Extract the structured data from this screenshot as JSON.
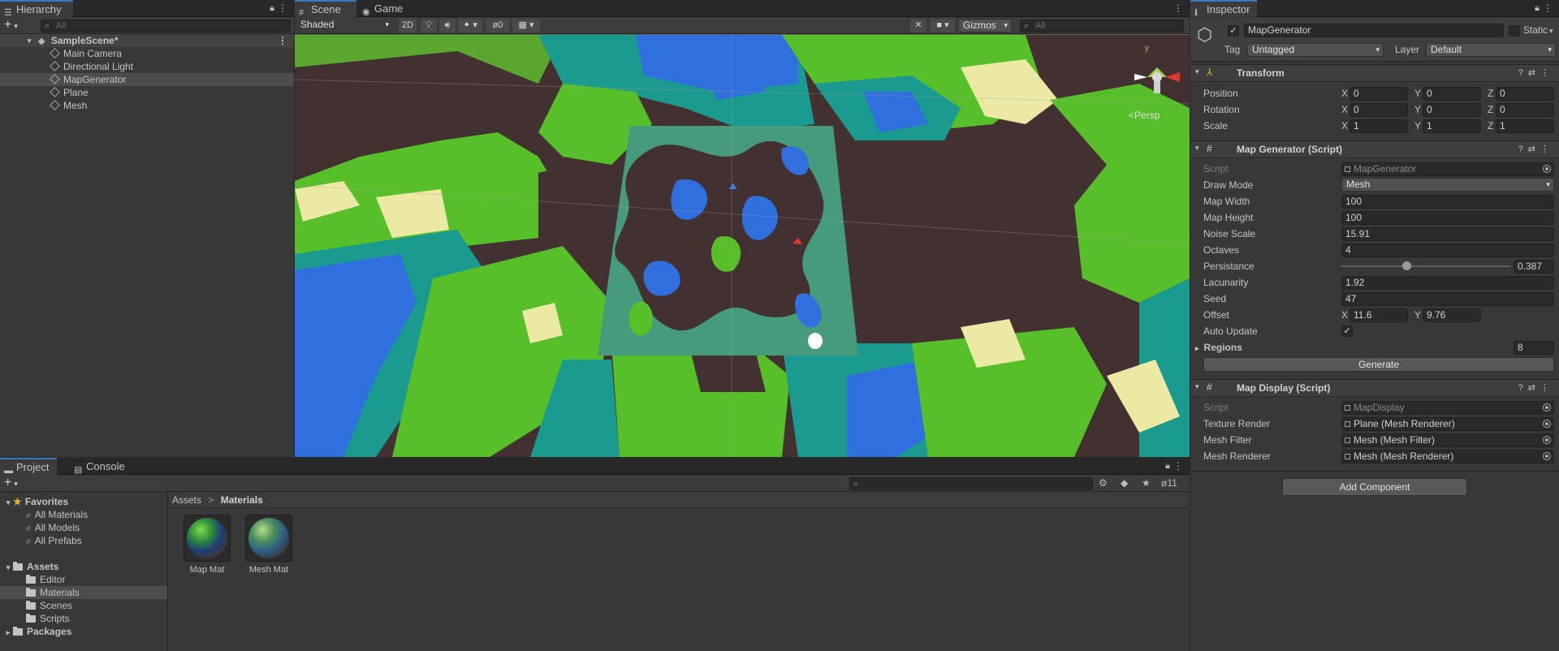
{
  "hierarchy": {
    "tab": "Hierarchy",
    "search_placeholder": "All",
    "scene": "SampleScene*",
    "items": [
      "Main Camera",
      "Directional Light",
      "MapGenerator",
      "Plane",
      "Mesh"
    ]
  },
  "scene_view": {
    "tabs": [
      "Scene",
      "Game"
    ],
    "shading": "Shaded",
    "mode_2d": "2D",
    "hidden_count": "0",
    "gizmos": "Gizmos",
    "search_placeholder": "All",
    "persp": "Persp",
    "axis_y": "y"
  },
  "project": {
    "tabs": [
      "Project",
      "Console"
    ],
    "favorites": {
      "label": "Favorites",
      "items": [
        "All Materials",
        "All Models",
        "All Prefabs"
      ]
    },
    "assets": {
      "label": "Assets",
      "items": [
        "Editor",
        "Materials",
        "Scenes",
        "Scripts"
      ]
    },
    "packages": "Packages",
    "breadcrumb": [
      "Assets",
      "Materials"
    ],
    "hidden_count": "11",
    "asset_items": [
      "Map Mat",
      "Mesh Mat"
    ]
  },
  "inspector": {
    "tab": "Inspector",
    "object_name": "MapGenerator",
    "static": "Static",
    "tag_label": "Tag",
    "tag": "Untagged",
    "layer_label": "Layer",
    "layer": "Default",
    "transform": {
      "title": "Transform",
      "rows": [
        {
          "label": "Position",
          "x": "0",
          "y": "0",
          "z": "0"
        },
        {
          "label": "Rotation",
          "x": "0",
          "y": "0",
          "z": "0"
        },
        {
          "label": "Scale",
          "x": "1",
          "y": "1",
          "z": "1"
        }
      ]
    },
    "map_generator": {
      "title": "Map Generator (Script)",
      "script_label": "Script",
      "script": "MapGenerator",
      "draw_mode_label": "Draw Mode",
      "draw_mode": "Mesh",
      "map_width_label": "Map Width",
      "map_width": "100",
      "map_height_label": "Map Height",
      "map_height": "100",
      "noise_scale_label": "Noise Scale",
      "noise_scale": "15.91",
      "octaves_label": "Octaves",
      "octaves": "4",
      "persistance_label": "Persistance",
      "persistance": "0.387",
      "persistance_fraction": 0.387,
      "lacunarity_label": "Lacunarity",
      "lacunarity": "1.92",
      "seed_label": "Seed",
      "seed": "47",
      "offset_label": "Offset",
      "offset_x": "11.6",
      "offset_y": "9.76",
      "auto_update_label": "Auto Update",
      "regions_label": "Regions",
      "regions_count": "8",
      "generate": "Generate"
    },
    "map_display": {
      "title": "Map Display (Script)",
      "script_label": "Script",
      "script": "MapDisplay",
      "texture_render_label": "Texture Render",
      "texture_render": "Plane (Mesh Renderer)",
      "mesh_filter_label": "Mesh Filter",
      "mesh_filter": "Mesh (Mesh Filter)",
      "mesh_renderer_label": "Mesh Renderer",
      "mesh_renderer": "Mesh (Mesh Renderer)"
    },
    "add_component": "Add Component"
  },
  "colors": {
    "accent": "#3a79bb",
    "panel": "#383838",
    "selection": "#4d4d4d"
  }
}
